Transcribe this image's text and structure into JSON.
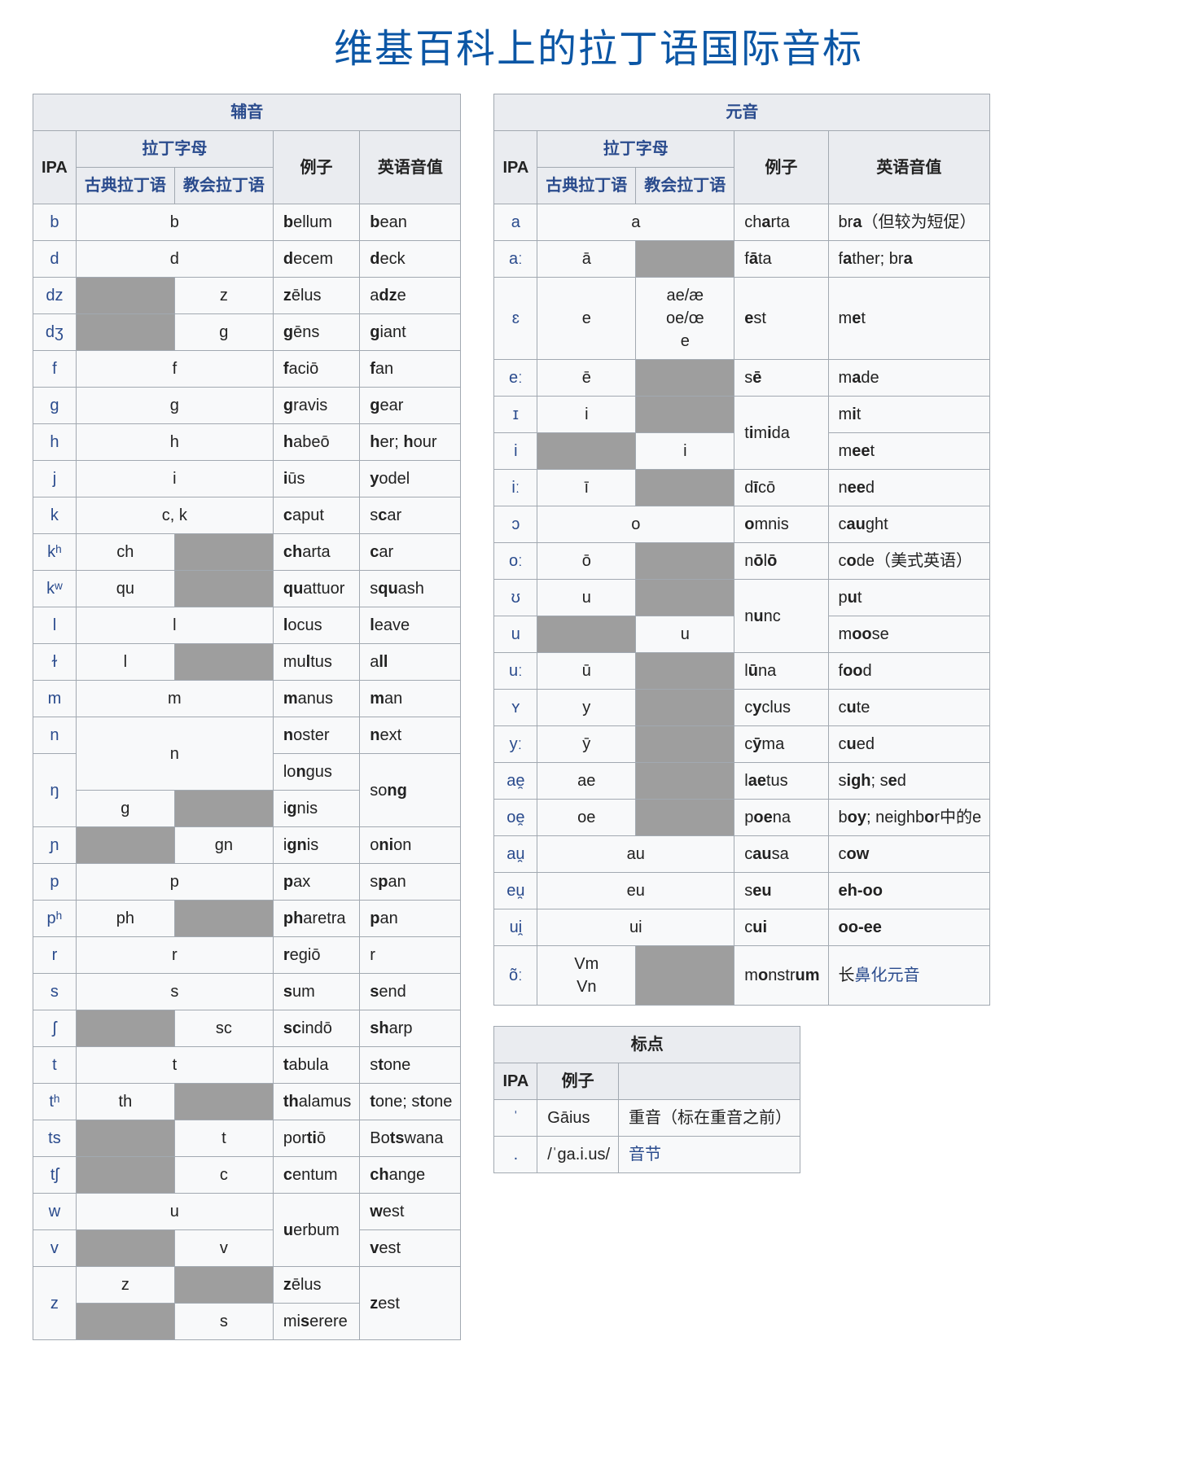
{
  "page_title": "维基百科上的拉丁语国际音标",
  "headers": {
    "consonants": "辅音",
    "vowels": "元音",
    "marks": "标点",
    "ipa": "IPA",
    "latin_letters": "拉丁字母",
    "classical": "古典拉丁语",
    "ecclesiastic": "教会拉丁语",
    "examples": "例子",
    "english": "英语音值"
  },
  "consonants": [
    {
      "ipa": "b",
      "cl": "b",
      "ec": "=",
      "ex": "<b>b</b>ellum",
      "en": "<b>b</b>ean"
    },
    {
      "ipa": "d",
      "cl": "d",
      "ec": "=",
      "ex": "<b>d</b>ecem",
      "en": "<b>d</b>eck"
    },
    {
      "ipa": "dz",
      "cl": null,
      "ec": "z",
      "ex": "<b>z</b>ēlus",
      "en": "a<b>dz</b>e"
    },
    {
      "ipa": "dʒ",
      "cl": null,
      "ec": "g",
      "ex": "<b>g</b>ēns",
      "en": "<b>g</b>iant"
    },
    {
      "ipa": "f",
      "cl": "f",
      "ec": "=",
      "ex": "<b>f</b>aciō",
      "en": "<b>f</b>an"
    },
    {
      "ipa": "ɡ",
      "cl": "g",
      "ec": "=",
      "ex": "<b>g</b>ravis",
      "en": "<b>g</b>ear"
    },
    {
      "ipa": "h",
      "cl": "h",
      "ec": "=",
      "ex": "<b>h</b>abeō",
      "en": "<b>h</b>er; <b>h</b>our"
    },
    {
      "ipa": "j",
      "cl": "i",
      "ec": "=",
      "ex": "<b>i</b>ūs",
      "en": "<b>y</b>odel"
    },
    {
      "ipa": "k",
      "cl": "c, k",
      "ec": "=",
      "ex": "<b>c</b>aput",
      "en": "s<b>c</b>ar"
    },
    {
      "ipa": "kʰ",
      "cl": "ch",
      "ec": null,
      "ex": "<b>ch</b>arta",
      "en": "<b>c</b>ar"
    },
    {
      "ipa": "kʷ",
      "cl": "qu",
      "ec": null,
      "ex": "<b>qu</b>attuor",
      "en": "s<b>qu</b>ash"
    },
    {
      "ipa": "l",
      "cl": "l",
      "ec": "=",
      "ex": "<b>l</b>ocus",
      "en": "<b>l</b>eave"
    },
    {
      "ipa": "ɫ",
      "cl": "l",
      "ec": null,
      "ex": "mu<b>l</b>tus",
      "en": "a<b>ll</b>"
    },
    {
      "ipa": "m",
      "cl": "m",
      "ec": "=",
      "ex": "<b>m</b>anus",
      "en": "<b>m</b>an"
    },
    {
      "ipa": "n",
      "cl": "n",
      "ec": "=",
      "rowspan_cl": 2,
      "ex": "<b>n</b>oster",
      "en": "<b>n</b>ext"
    },
    {
      "ipa": "ŋ",
      "ex": "lo<b>n</b>gus",
      "en": "so<b>ng</b>",
      "rowspan_en": 2,
      "rowspan_ipa": 2
    },
    {
      "cl": "g",
      "ec": null,
      "ex": "i<b>g</b>nis"
    },
    {
      "ipa": "ɲ",
      "cl": null,
      "ec": "gn",
      "ex": "i<b>gn</b>is",
      "en": "o<b>ni</b>on"
    },
    {
      "ipa": "p",
      "cl": "p",
      "ec": "=",
      "ex": "<b>p</b>ax",
      "en": "s<b>p</b>an"
    },
    {
      "ipa": "pʰ",
      "cl": "ph",
      "ec": null,
      "ex": "<b>ph</b>aretra",
      "en": "<b>p</b>an"
    },
    {
      "ipa": "r",
      "cl": "r",
      "ec": "=",
      "ex": "<b>r</b>egiō",
      "en": "r"
    },
    {
      "ipa": "s",
      "cl": "s",
      "ec": "=",
      "ex": "<b>s</b>um",
      "en": "<b>s</b>end"
    },
    {
      "ipa": "ʃ",
      "cl": null,
      "ec": "sc",
      "ex": "<b>sc</b>indō",
      "en": "<b>sh</b>arp"
    },
    {
      "ipa": "t",
      "cl": "t",
      "ec": "=",
      "ex": "<b>t</b>abula",
      "en": "s<b>t</b>one"
    },
    {
      "ipa": "tʰ",
      "cl": "th",
      "ec": null,
      "ex": "<b>th</b>alamus",
      "en": "<b>t</b>one; s<b>t</b>one"
    },
    {
      "ipa": "ts",
      "cl": null,
      "ec": "t",
      "ex": "por<b>ti</b>ō",
      "en": "Bo<b>ts</b>wana"
    },
    {
      "ipa": "tʃ",
      "cl": null,
      "ec": "c",
      "ex": "<b>c</b>entum",
      "en": "<b>ch</b>ange"
    },
    {
      "ipa": "w",
      "cl": "u",
      "ec": "=",
      "ex": "<b>u</b>erbum",
      "rowspan_ex": 2,
      "en": "<b>w</b>est"
    },
    {
      "ipa": "v",
      "cl": null,
      "ec": "v",
      "en": "<b>v</b>est"
    },
    {
      "ipa": "z",
      "rowspan_ipa": 2,
      "cl": "z",
      "ec": null,
      "ex": "<b>z</b>ēlus",
      "en": "<b>z</b>est",
      "rowspan_en": 2
    },
    {
      "cl": null,
      "ec": "s",
      "ex": "mi<b>s</b>erere"
    }
  ],
  "vowels": [
    {
      "ipa": "a",
      "cl": "a",
      "ec": "=",
      "ex": "ch<b>a</b>rta",
      "en": "br<b>a</b>（但较为短促）"
    },
    {
      "ipa": "aː",
      "cl": "ā",
      "ec": null,
      "ex": "f<b>ā</b>ta",
      "en": "f<b>a</b>ther; br<b>a</b>"
    },
    {
      "ipa": "ɛ",
      "cl": "e",
      "ec": "ae/æ<br>oe/œ<br>e",
      "ex": "<b>e</b>st",
      "en": "m<b>e</b>t"
    },
    {
      "ipa": "eː",
      "cl": "ē",
      "ec": null,
      "ex": "s<b>ē</b>",
      "en": "m<b>a</b>de"
    },
    {
      "ipa": "ɪ",
      "cl": "i",
      "ec": null,
      "ex": "t<b>i</b>m<b>i</b>da",
      "rowspan_ex": 2,
      "en": "m<b>i</b>t"
    },
    {
      "ipa": "i",
      "cl": null,
      "ec": "i",
      "en": "m<b>ee</b>t"
    },
    {
      "ipa": "iː",
      "cl": "ī",
      "ec": null,
      "ex": "d<b>ī</b>cō",
      "en": "n<b>ee</b>d"
    },
    {
      "ipa": "ɔ",
      "cl": "o",
      "ec": "=",
      "ex": "<b>o</b>mnis",
      "en": "c<b>au</b>ght"
    },
    {
      "ipa": "oː",
      "cl": "ō",
      "ec": null,
      "ex": "n<b>ō</b>l<b>ō</b>",
      "en": "c<b>o</b>de（美式英语）"
    },
    {
      "ipa": "ʊ",
      "cl": "u",
      "ec": null,
      "ex": "n<b>u</b>nc",
      "rowspan_ex": 2,
      "en": "p<b>u</b>t"
    },
    {
      "ipa": "u",
      "cl": null,
      "ec": "u",
      "en": "m<b>oo</b>se"
    },
    {
      "ipa": "uː",
      "cl": "ū",
      "ec": null,
      "ex": "l<b>ū</b>na",
      "en": "f<b>oo</b>d"
    },
    {
      "ipa": "ʏ",
      "cl": "y",
      "ec": null,
      "ex": "c<b>y</b>clus",
      "en": "c<b>u</b>te"
    },
    {
      "ipa": "yː",
      "cl": "ȳ",
      "ec": null,
      "ex": "c<b>ȳ</b>ma",
      "en": "c<b>u</b>ed"
    },
    {
      "ipa": "ae̯",
      "cl": "ae",
      "ec": null,
      "ex": "l<b>ae</b>tus",
      "en": "s<b>igh</b>; s<b>e</b>d"
    },
    {
      "ipa": "oe̯",
      "cl": "oe",
      "ec": null,
      "ex": "p<b>oe</b>na",
      "en": "b<b>oy</b>; neighb<b>o</b>r中的e"
    },
    {
      "ipa": "au̯",
      "cl": "au",
      "ec": "=",
      "ex": "c<b>au</b>sa",
      "en": "c<b>ow</b>"
    },
    {
      "ipa": "eu̯",
      "cl": "eu",
      "ec": "=",
      "ex": "s<b>eu</b>",
      "en": "<b>eh-oo</b>"
    },
    {
      "ipa": "ui̯",
      "cl": "ui",
      "ec": "=",
      "ex": "c<b>ui</b>",
      "en": "<b>oo-ee</b>"
    },
    {
      "ipa": "õː",
      "cl": "Vm<br>Vn",
      "ec": null,
      "ex": "m<b>o</b>nstr<b>um</b>",
      "en_link": "长鼻化元音",
      "en_link_pre": "长",
      "en_link_txt": "鼻化元音"
    }
  ],
  "marks": [
    {
      "ipa": "ˈ",
      "ex": "Gāius",
      "en": "重音（标在重音之前）"
    },
    {
      "ipa": ".",
      "ex": "/ˈɡa.i.us/",
      "en_link": "音节"
    }
  ]
}
